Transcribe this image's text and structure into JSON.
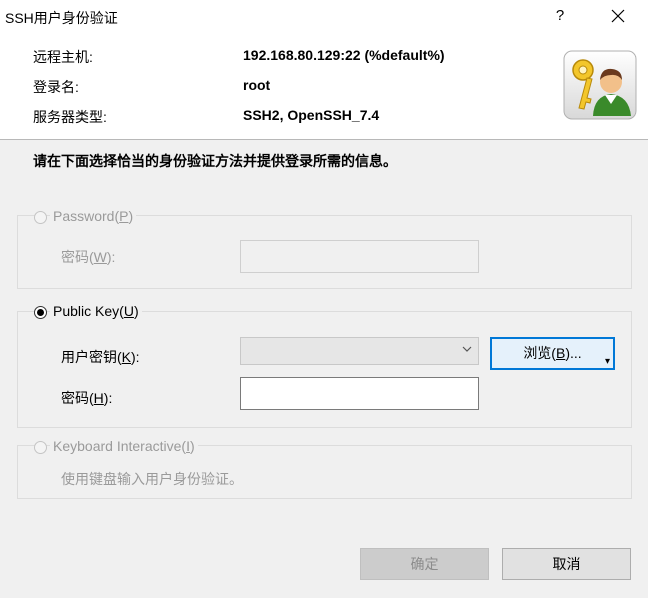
{
  "window": {
    "title": "SSH用户身份验证",
    "help_label": "?"
  },
  "info": {
    "host_label": "远程主机:",
    "host_value": "192.168.80.129:22 (%default%)",
    "login_label": "登录名:",
    "login_value": "root",
    "server_label": "服务器类型:",
    "server_value": "SSH2, OpenSSH_7.4"
  },
  "instruction": "请在下面选择恰当的身份验证方法并提供登录所需的信息。",
  "password_group": {
    "legend_text": "Password(",
    "legend_key": "P",
    "legend_end": ")",
    "field_label_text": "密码(",
    "field_label_key": "W",
    "field_label_end": "):"
  },
  "pubkey_group": {
    "legend_text": "Public Key(",
    "legend_key": "U",
    "legend_end": ")",
    "key_label_text": "用户密钥(",
    "key_label_key": "K",
    "key_label_end": "):",
    "pass_label_text": "密码(",
    "pass_label_key": "H",
    "pass_label_end": "):",
    "browse_text": "浏览(",
    "browse_key": "B",
    "browse_end": ")...",
    "browse_caret": "▾"
  },
  "keyboard_group": {
    "legend_text": "Keyboard Interactive(",
    "legend_key": "I",
    "legend_end": ")",
    "description": "使用键盘输入用户身份验证。"
  },
  "buttons": {
    "ok": "确定",
    "cancel": "取消"
  },
  "colors": {
    "accent": "#0078d7",
    "disabled_text": "#9a9a9a"
  }
}
